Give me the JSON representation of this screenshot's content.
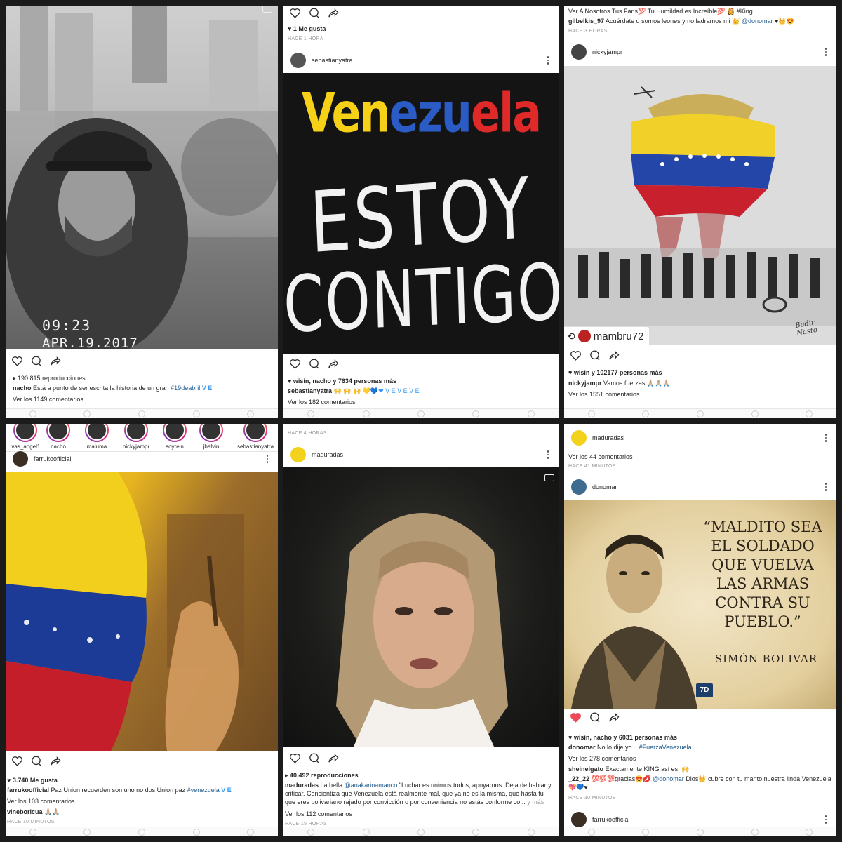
{
  "p1": {
    "timestamp": "09:23",
    "date": "APR.19.2017",
    "views": "190.815 reproducciones",
    "caption_user": "nacho",
    "caption_text": "Está a punto de ser escrita la historia de un gran",
    "caption_tag": "#19deabril",
    "caption_flag": "V E",
    "comments": "Ver los 1149 comentarios"
  },
  "p2": {
    "likes": "1 Me gusta",
    "time_top": "HACE 1 HORA",
    "username": "sebastianyatra",
    "art_word": "Venezuela",
    "art_line2": "ESTOY",
    "art_line3": "CONTIGO",
    "liked_by_names": "wisin, nacho",
    "liked_by_rest": "y 7634 personas más",
    "caption_user": "sebastianyatra",
    "caption_text": "🙌 🙌 🙌 💛💙❤ V E V E V E",
    "comments": "Ver los 182 comentarios"
  },
  "p3": {
    "top_line": "Ver A Nosotros Tus Fans💯 Tu Humildad es Increíble💯 👸 #King",
    "cmt_user": "gilbelkis_97",
    "cmt_text": "Acuérdate q somos leones y no ladramos mi 👑",
    "cmt_mention": "@donomar",
    "time_top": "HACE 3 HORAS",
    "username": "nickyjampr",
    "regram_user": "mambru72",
    "signature": "Badir Nasto",
    "liked_by_names": "wisin",
    "liked_by_rest": "y 102177 personas más",
    "caption_user": "nickyjampr",
    "caption_text": "Vamos fuerzas 🙏🏼🙏🏼🙏🏼",
    "comments": "Ver los 1551 comentarios"
  },
  "p4": {
    "stories": [
      "ivas_angel1",
      "nacho",
      "maluma",
      "nickyjampr",
      "soyrein",
      "jbalvin",
      "sebastianyatra"
    ],
    "username": "farrukoofficial",
    "likes": "3.740 Me gusta",
    "caption_user": "farrukoofficial",
    "caption_text": "Paz Union recuerden son uno no dos Union paz",
    "caption_tag": "#venezuela",
    "caption_flag": "V E",
    "comments": "Ver los 103 comentarios",
    "c1_user": "vineboricua",
    "c1_text": "🙏🏼🙏🏼",
    "time_bottom": "HACE 10 MINUTOS"
  },
  "p5": {
    "time_top": "HACE 4 HORAS",
    "username": "maduradas",
    "views": "40.492 reproducciones",
    "caption_user": "maduradas",
    "caption_pre": "La bella",
    "caption_mention": "@anakarinamanco",
    "caption_text": "\"Luchar es unirnos todos, apoyarnos. Deja de hablar y criticar. Concientiza que Venezuela está realmente mal, que ya no es la misma, que hasta tu que eres bolivariano rajado por convicción o por conveniencia no estás conforme co...",
    "more": "y más",
    "comments": "Ver los 112 comentarios",
    "time_bottom": "HACE 15 HORAS"
  },
  "p6": {
    "top_user": "maduradas",
    "top_comments": "Ver los 44 comentarios",
    "top_time": "HACE 41 MINUTOS",
    "username": "donomar",
    "quote": "“MALDITO SEA EL SOLDADO QUE VUELVA LAS ARMAS CONTRA SU PUEBLO.”",
    "quote_author": "SIMÓN BOLIVAR",
    "badge": "7D",
    "liked_by_names": "wisin, nacho",
    "liked_by_rest": "y 6031 personas más",
    "caption_user": "donomar",
    "caption_text": "No lo dije yo...",
    "caption_tag": "#FuerzaVenezuela",
    "comments": "Ver los 278 comentarios",
    "c1_user": "sheinelgato",
    "c1_text": "Exactamente KING así es! 🙌",
    "c2_user": "_22_22",
    "c2_text": "💯💯💯gracias😍💋",
    "c2_mention": "@donomar",
    "c2_text2": "Dios👑 cubre con tu manto nuestra linda Venezuela 💖💙♥",
    "time_bottom": "HACE 30 MINUTOS",
    "next_user": "farrukoofficial"
  },
  "colors": {
    "link": "#1f5a8c",
    "heart_liked": "#ed4956",
    "flag_yellow": "#f7d117",
    "flag_blue": "#1d3f9a",
    "flag_red": "#cf1f2e"
  }
}
